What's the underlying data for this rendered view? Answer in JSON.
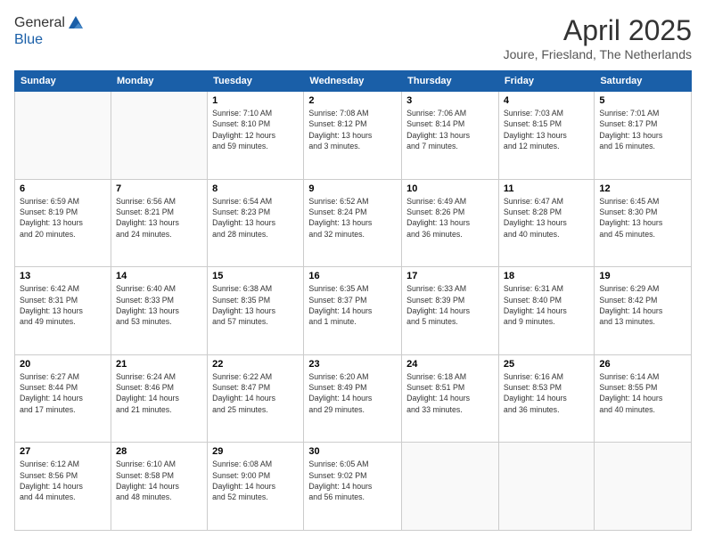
{
  "logo": {
    "general": "General",
    "blue": "Blue"
  },
  "title": {
    "month_year": "April 2025",
    "location": "Joure, Friesland, The Netherlands"
  },
  "days_of_week": [
    "Sunday",
    "Monday",
    "Tuesday",
    "Wednesday",
    "Thursday",
    "Friday",
    "Saturday"
  ],
  "weeks": [
    [
      {
        "day": "",
        "info": ""
      },
      {
        "day": "",
        "info": ""
      },
      {
        "day": "1",
        "info": "Sunrise: 7:10 AM\nSunset: 8:10 PM\nDaylight: 12 hours\nand 59 minutes."
      },
      {
        "day": "2",
        "info": "Sunrise: 7:08 AM\nSunset: 8:12 PM\nDaylight: 13 hours\nand 3 minutes."
      },
      {
        "day": "3",
        "info": "Sunrise: 7:06 AM\nSunset: 8:14 PM\nDaylight: 13 hours\nand 7 minutes."
      },
      {
        "day": "4",
        "info": "Sunrise: 7:03 AM\nSunset: 8:15 PM\nDaylight: 13 hours\nand 12 minutes."
      },
      {
        "day": "5",
        "info": "Sunrise: 7:01 AM\nSunset: 8:17 PM\nDaylight: 13 hours\nand 16 minutes."
      }
    ],
    [
      {
        "day": "6",
        "info": "Sunrise: 6:59 AM\nSunset: 8:19 PM\nDaylight: 13 hours\nand 20 minutes."
      },
      {
        "day": "7",
        "info": "Sunrise: 6:56 AM\nSunset: 8:21 PM\nDaylight: 13 hours\nand 24 minutes."
      },
      {
        "day": "8",
        "info": "Sunrise: 6:54 AM\nSunset: 8:23 PM\nDaylight: 13 hours\nand 28 minutes."
      },
      {
        "day": "9",
        "info": "Sunrise: 6:52 AM\nSunset: 8:24 PM\nDaylight: 13 hours\nand 32 minutes."
      },
      {
        "day": "10",
        "info": "Sunrise: 6:49 AM\nSunset: 8:26 PM\nDaylight: 13 hours\nand 36 minutes."
      },
      {
        "day": "11",
        "info": "Sunrise: 6:47 AM\nSunset: 8:28 PM\nDaylight: 13 hours\nand 40 minutes."
      },
      {
        "day": "12",
        "info": "Sunrise: 6:45 AM\nSunset: 8:30 PM\nDaylight: 13 hours\nand 45 minutes."
      }
    ],
    [
      {
        "day": "13",
        "info": "Sunrise: 6:42 AM\nSunset: 8:31 PM\nDaylight: 13 hours\nand 49 minutes."
      },
      {
        "day": "14",
        "info": "Sunrise: 6:40 AM\nSunset: 8:33 PM\nDaylight: 13 hours\nand 53 minutes."
      },
      {
        "day": "15",
        "info": "Sunrise: 6:38 AM\nSunset: 8:35 PM\nDaylight: 13 hours\nand 57 minutes."
      },
      {
        "day": "16",
        "info": "Sunrise: 6:35 AM\nSunset: 8:37 PM\nDaylight: 14 hours\nand 1 minute."
      },
      {
        "day": "17",
        "info": "Sunrise: 6:33 AM\nSunset: 8:39 PM\nDaylight: 14 hours\nand 5 minutes."
      },
      {
        "day": "18",
        "info": "Sunrise: 6:31 AM\nSunset: 8:40 PM\nDaylight: 14 hours\nand 9 minutes."
      },
      {
        "day": "19",
        "info": "Sunrise: 6:29 AM\nSunset: 8:42 PM\nDaylight: 14 hours\nand 13 minutes."
      }
    ],
    [
      {
        "day": "20",
        "info": "Sunrise: 6:27 AM\nSunset: 8:44 PM\nDaylight: 14 hours\nand 17 minutes."
      },
      {
        "day": "21",
        "info": "Sunrise: 6:24 AM\nSunset: 8:46 PM\nDaylight: 14 hours\nand 21 minutes."
      },
      {
        "day": "22",
        "info": "Sunrise: 6:22 AM\nSunset: 8:47 PM\nDaylight: 14 hours\nand 25 minutes."
      },
      {
        "day": "23",
        "info": "Sunrise: 6:20 AM\nSunset: 8:49 PM\nDaylight: 14 hours\nand 29 minutes."
      },
      {
        "day": "24",
        "info": "Sunrise: 6:18 AM\nSunset: 8:51 PM\nDaylight: 14 hours\nand 33 minutes."
      },
      {
        "day": "25",
        "info": "Sunrise: 6:16 AM\nSunset: 8:53 PM\nDaylight: 14 hours\nand 36 minutes."
      },
      {
        "day": "26",
        "info": "Sunrise: 6:14 AM\nSunset: 8:55 PM\nDaylight: 14 hours\nand 40 minutes."
      }
    ],
    [
      {
        "day": "27",
        "info": "Sunrise: 6:12 AM\nSunset: 8:56 PM\nDaylight: 14 hours\nand 44 minutes."
      },
      {
        "day": "28",
        "info": "Sunrise: 6:10 AM\nSunset: 8:58 PM\nDaylight: 14 hours\nand 48 minutes."
      },
      {
        "day": "29",
        "info": "Sunrise: 6:08 AM\nSunset: 9:00 PM\nDaylight: 14 hours\nand 52 minutes."
      },
      {
        "day": "30",
        "info": "Sunrise: 6:05 AM\nSunset: 9:02 PM\nDaylight: 14 hours\nand 56 minutes."
      },
      {
        "day": "",
        "info": ""
      },
      {
        "day": "",
        "info": ""
      },
      {
        "day": "",
        "info": ""
      }
    ]
  ]
}
